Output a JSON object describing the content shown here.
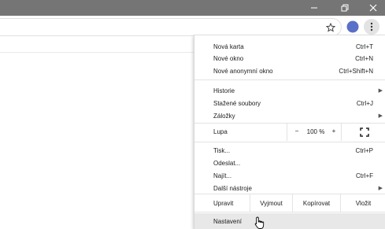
{
  "colors": {
    "titlebar": "#757575",
    "profile": "#5a6fc7",
    "settings_highlight": "#e8e8e8"
  },
  "window": {
    "minimize_icon": "minimize-icon",
    "restore_icon": "restore-icon",
    "close_icon": "close-icon"
  },
  "toolbar": {
    "bookmark_icon": "star-icon",
    "profile_icon": "avatar",
    "menu_icon": "kebab-menu-icon"
  },
  "menu": {
    "items_top": [
      {
        "label": "Nová karta",
        "shortcut": "Ctrl+T"
      },
      {
        "label": "Nové okno",
        "shortcut": "Ctrl+N"
      },
      {
        "label": "Nové anonymní okno",
        "shortcut": "Ctrl+Shift+N"
      }
    ],
    "items_history": [
      {
        "label": "Historie",
        "shortcut": "",
        "submenu": true
      },
      {
        "label": "Stažené soubory",
        "shortcut": "Ctrl+J",
        "submenu": false
      },
      {
        "label": "Záložky",
        "shortcut": "",
        "submenu": true
      }
    ],
    "zoom": {
      "label": "Lupa",
      "minus": "−",
      "value": "100 %",
      "plus": "+",
      "fullscreen_icon": "fullscreen-icon"
    },
    "items_tools": [
      {
        "label": "Tisk...",
        "shortcut": "Ctrl+P",
        "submenu": false
      },
      {
        "label": "Odeslat...",
        "shortcut": "",
        "submenu": false
      },
      {
        "label": "Najít...",
        "shortcut": "Ctrl+F",
        "submenu": false
      },
      {
        "label": "Další nástroje",
        "shortcut": "",
        "submenu": true
      }
    ],
    "edit": {
      "label": "Upravit",
      "cut": "Vyjmout",
      "copy": "Kopírovat",
      "paste": "Vložit"
    },
    "settings": {
      "label": "Nastavení"
    }
  }
}
